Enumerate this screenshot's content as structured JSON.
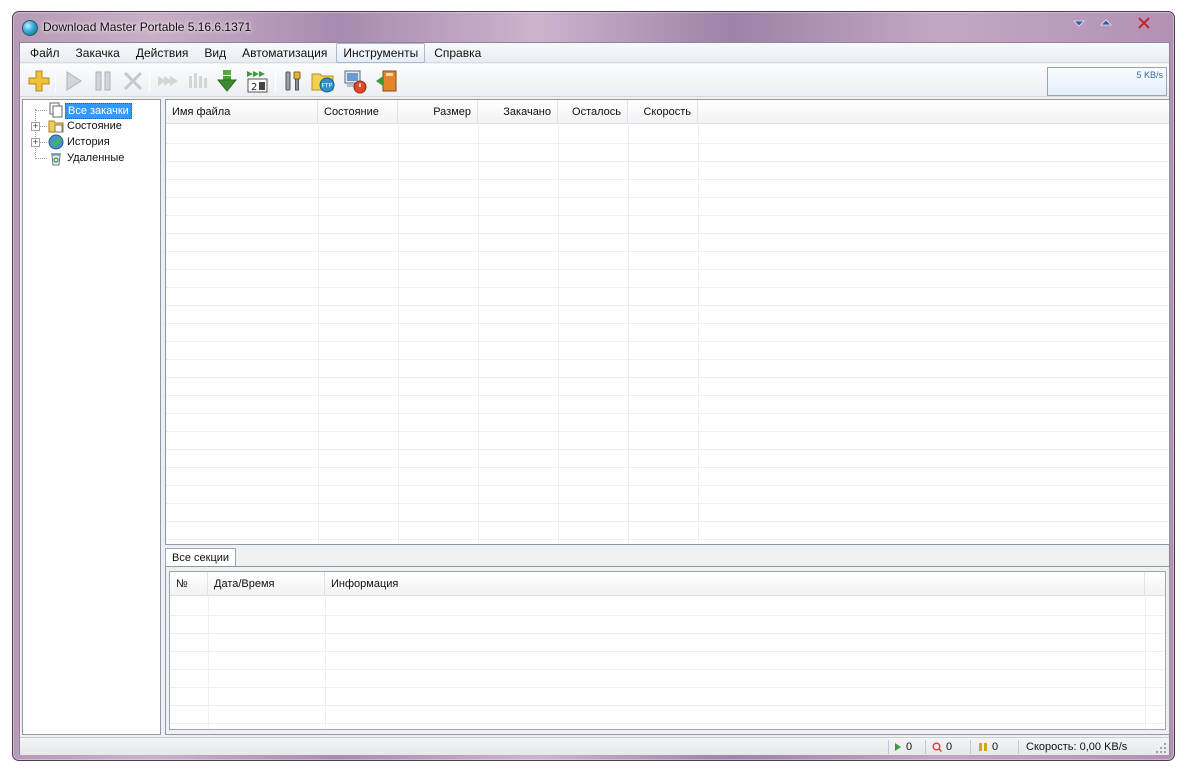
{
  "window": {
    "title": "Download Master Portable 5.16.6.1371"
  },
  "menu": [
    "Файл",
    "Закачка",
    "Действия",
    "Вид",
    "Автоматизация",
    "Инструменты",
    "Справка"
  ],
  "menu_active_index": 5,
  "toolbar": {
    "speed_label": "5 KB/s",
    "buttons": [
      {
        "name": "add-download",
        "icon": "plus-icon"
      },
      {
        "name": "start",
        "icon": "play-icon"
      },
      {
        "name": "pause",
        "icon": "pause-icon"
      },
      {
        "name": "delete",
        "icon": "x-icon"
      },
      {
        "name": "start-all",
        "icon": "fast-forward-icon"
      },
      {
        "name": "pause-all",
        "icon": "pause-all-icon"
      },
      {
        "name": "download-down",
        "icon": "green-down-arrow-icon"
      },
      {
        "name": "scheduler",
        "icon": "scheduler-icon"
      },
      {
        "name": "settings",
        "icon": "tools-icon"
      },
      {
        "name": "ftp-explorer",
        "icon": "ftp-folder-icon"
      },
      {
        "name": "shutdown",
        "icon": "computer-power-icon"
      },
      {
        "name": "exit",
        "icon": "exit-door-icon"
      }
    ]
  },
  "tree": {
    "items": [
      {
        "label": "Все закачки",
        "selected": true,
        "expandable": false,
        "icon": "pages-icon"
      },
      {
        "label": "Состояние",
        "selected": false,
        "expandable": true,
        "icon": "status-folder-icon"
      },
      {
        "label": "История",
        "selected": false,
        "expandable": true,
        "icon": "history-check-icon"
      },
      {
        "label": "Удаленные",
        "selected": false,
        "expandable": false,
        "icon": "recycle-bin-icon"
      }
    ]
  },
  "downloads": {
    "columns": [
      "Имя файла",
      "Состояние",
      "Размер",
      "Закачано",
      "Осталось",
      "Скорость"
    ],
    "rows": []
  },
  "log": {
    "tab": "Все секции",
    "columns": [
      "№",
      "Дата/Время",
      "Информация"
    ],
    "rows": []
  },
  "statusbar": {
    "active_count": "0",
    "queued_count": "0",
    "paused_count": "0",
    "speed_text": "Скорость: 0,00 KB/s"
  },
  "colors": {
    "selection": "#3399ff",
    "speed_text": "#3a66b0"
  }
}
